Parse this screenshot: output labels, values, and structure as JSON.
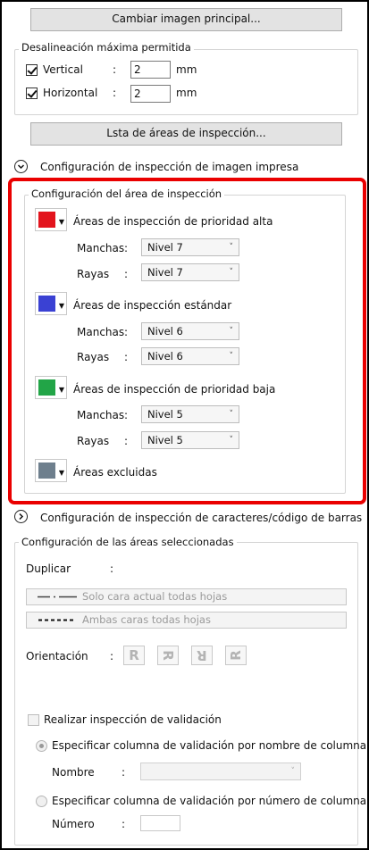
{
  "top_button": "Cambiar imagen principal...",
  "misalignment": {
    "title": "Desalineación máxima permitida",
    "rows": [
      {
        "label": "Vertical",
        "colon": ":",
        "value": "2",
        "unit": "mm",
        "checked": true
      },
      {
        "label": "Horizontal",
        "colon": ":",
        "value": "2",
        "unit": "mm",
        "checked": true
      }
    ]
  },
  "areas_list_button": "Lsta de áreas de inspección...",
  "print_section": {
    "title": "Configuración de inspección de imagen impresa",
    "expanded": true
  },
  "area_config": {
    "title": "Configuración del área de inspección",
    "groups": [
      {
        "name": "Áreas de inspección de prioridad alta",
        "color": "#e3141d",
        "manchas_label": "Manchas",
        "manchas": "Nivel 7",
        "rayas_label": "Rayas",
        "rayas": "Nivel 7"
      },
      {
        "name": "Áreas de inspección estándar",
        "color": "#3a41d3",
        "manchas_label": "Manchas",
        "manchas": "Nivel 6",
        "rayas_label": "Rayas",
        "rayas": "Nivel 6"
      },
      {
        "name": "Áreas de inspección de prioridad baja",
        "color": "#22a547",
        "manchas_label": "Manchas",
        "manchas": "Nivel 5",
        "rayas_label": "Rayas",
        "rayas": "Nivel 5"
      }
    ],
    "excluded": {
      "name": "Áreas excluidas",
      "color": "#6e7f8d"
    },
    "colon": ":"
  },
  "char_section": {
    "title": "Configuración de inspección de caracteres/código de barras",
    "expanded": false
  },
  "selected_areas": {
    "title": "Configuración de las áreas seleccionadas",
    "duplicate_label": "Duplicar",
    "colon": ":",
    "duplicate_options": [
      "Solo cara actual todas hojas",
      "Ambas caras todas hojas"
    ],
    "orientation_label": "Orientación",
    "orientation_icons": [
      "R",
      "R",
      "R",
      "R"
    ],
    "validation_checkbox": "Realizar inspección de validación",
    "radio_name": "Especificar columna de validación por nombre de columna",
    "name_label": "Nombre",
    "name_value": "",
    "radio_number": "Especificar columna de validación por número de columna",
    "number_label": "Número",
    "number_value": ""
  },
  "colors": {
    "highlight": "#ea0000"
  }
}
